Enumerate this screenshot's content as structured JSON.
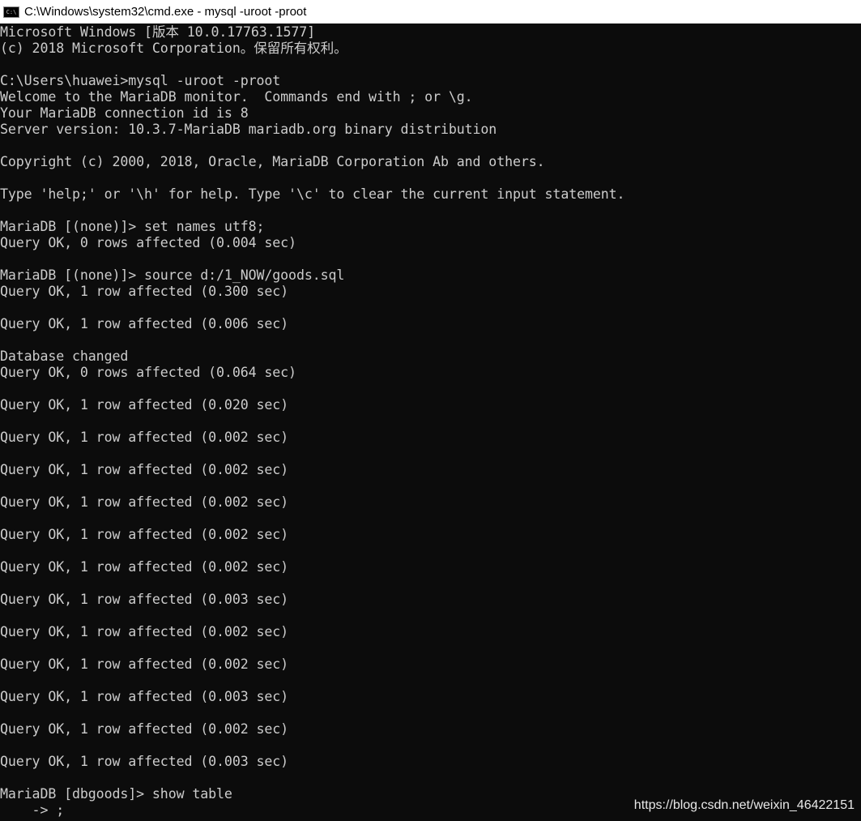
{
  "window": {
    "title": "C:\\Windows\\system32\\cmd.exe - mysql  -uroot -proot",
    "icon": "cmd-icon"
  },
  "console_lines": [
    "Microsoft Windows [版本 10.0.17763.1577]",
    "(c) 2018 Microsoft Corporation。保留所有权利。",
    "",
    "C:\\Users\\huawei>mysql -uroot -proot",
    "Welcome to the MariaDB monitor.  Commands end with ; or \\g.",
    "Your MariaDB connection id is 8",
    "Server version: 10.3.7-MariaDB mariadb.org binary distribution",
    "",
    "Copyright (c) 2000, 2018, Oracle, MariaDB Corporation Ab and others.",
    "",
    "Type 'help;' or '\\h' for help. Type '\\c' to clear the current input statement.",
    "",
    "MariaDB [(none)]> set names utf8;",
    "Query OK, 0 rows affected (0.004 sec)",
    "",
    "MariaDB [(none)]> source d:/1_NOW/goods.sql",
    "Query OK, 1 row affected (0.300 sec)",
    "",
    "Query OK, 1 row affected (0.006 sec)",
    "",
    "Database changed",
    "Query OK, 0 rows affected (0.064 sec)",
    "",
    "Query OK, 1 row affected (0.020 sec)",
    "",
    "Query OK, 1 row affected (0.002 sec)",
    "",
    "Query OK, 1 row affected (0.002 sec)",
    "",
    "Query OK, 1 row affected (0.002 sec)",
    "",
    "Query OK, 1 row affected (0.002 sec)",
    "",
    "Query OK, 1 row affected (0.002 sec)",
    "",
    "Query OK, 1 row affected (0.003 sec)",
    "",
    "Query OK, 1 row affected (0.002 sec)",
    "",
    "Query OK, 1 row affected (0.002 sec)",
    "",
    "Query OK, 1 row affected (0.003 sec)",
    "",
    "Query OK, 1 row affected (0.002 sec)",
    "",
    "Query OK, 1 row affected (0.003 sec)",
    "",
    "MariaDB [dbgoods]> show table",
    "    -> ;"
  ],
  "watermark": "https://blog.csdn.net/weixin_46422151"
}
